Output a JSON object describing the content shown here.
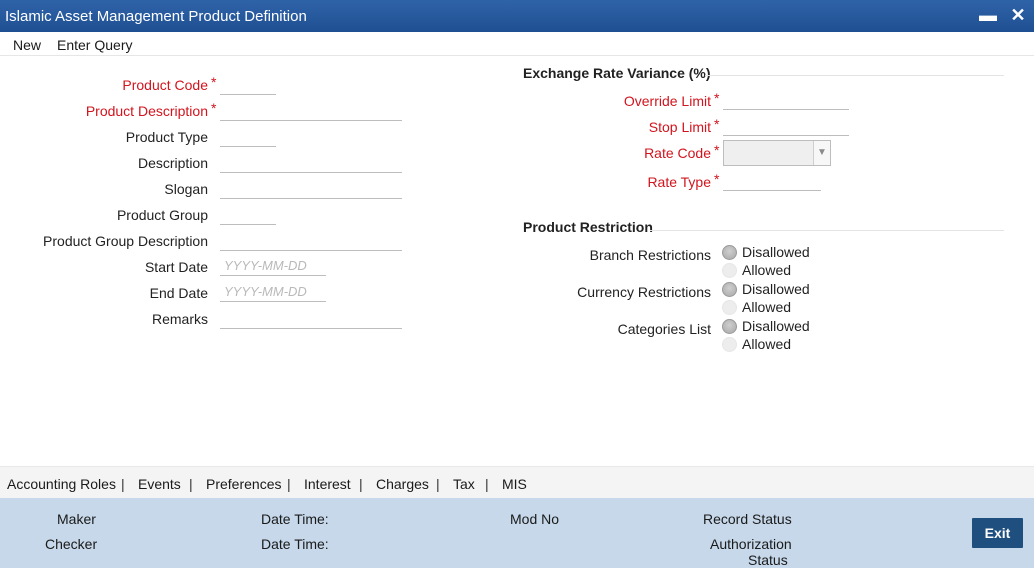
{
  "window": {
    "title": "Islamic Asset Management Product Definition",
    "minimize_glyph": "▬",
    "close_glyph": "✕"
  },
  "menu": {
    "new": "New",
    "enter_query": "Enter Query"
  },
  "main": {
    "product_code": {
      "label": "Product Code",
      "value": ""
    },
    "product_description": {
      "label": "Product Description",
      "value": ""
    },
    "product_type": {
      "label": "Product Type",
      "value": ""
    },
    "description": {
      "label": "Description",
      "value": ""
    },
    "slogan": {
      "label": "Slogan",
      "value": ""
    },
    "product_group": {
      "label": "Product Group",
      "value": ""
    },
    "product_group_description": {
      "label": "Product Group Description",
      "value": ""
    },
    "start_date": {
      "label": "Start Date",
      "placeholder": "YYYY-MM-DD",
      "value": ""
    },
    "end_date": {
      "label": "End Date",
      "placeholder": "YYYY-MM-DD",
      "value": ""
    },
    "remarks": {
      "label": "Remarks",
      "value": ""
    }
  },
  "exchange": {
    "heading": "Exchange Rate Variance (%)",
    "override_limit": {
      "label": "Override Limit",
      "value": ""
    },
    "stop_limit": {
      "label": "Stop Limit",
      "value": ""
    },
    "rate_code": {
      "label": "Rate Code",
      "value": ""
    },
    "rate_type": {
      "label": "Rate Type",
      "value": ""
    }
  },
  "restriction": {
    "heading": "Product Restriction",
    "branch": {
      "label": "Branch Restrictions",
      "opt1": "Disallowed",
      "opt2": "Allowed",
      "selected": "Disallowed"
    },
    "currency": {
      "label": "Currency Restrictions",
      "opt1": "Disallowed",
      "opt2": "Allowed",
      "selected": "Disallowed"
    },
    "categories": {
      "label": "Categories List",
      "opt1": "Disallowed",
      "opt2": "Allowed",
      "selected": "Disallowed"
    }
  },
  "required_mark": "*",
  "tabs": {
    "accounting_roles": "Accounting Roles",
    "events": "Events",
    "preferences": "Preferences",
    "interest": "Interest",
    "charges": "Charges",
    "tax": "Tax",
    "mis": "MIS",
    "separator": "|"
  },
  "footer": {
    "maker": "Maker",
    "checker": "Checker",
    "date_time": "Date Time:",
    "mod_no": "Mod No",
    "record_status": "Record Status",
    "authorization": "Authorization",
    "status": "Status",
    "exit": "Exit"
  },
  "colors": {
    "title_bar": "#1f4f93",
    "required": "#d2141e",
    "footer": "#c6d8ea",
    "exit_button": "#1f4f7e"
  }
}
